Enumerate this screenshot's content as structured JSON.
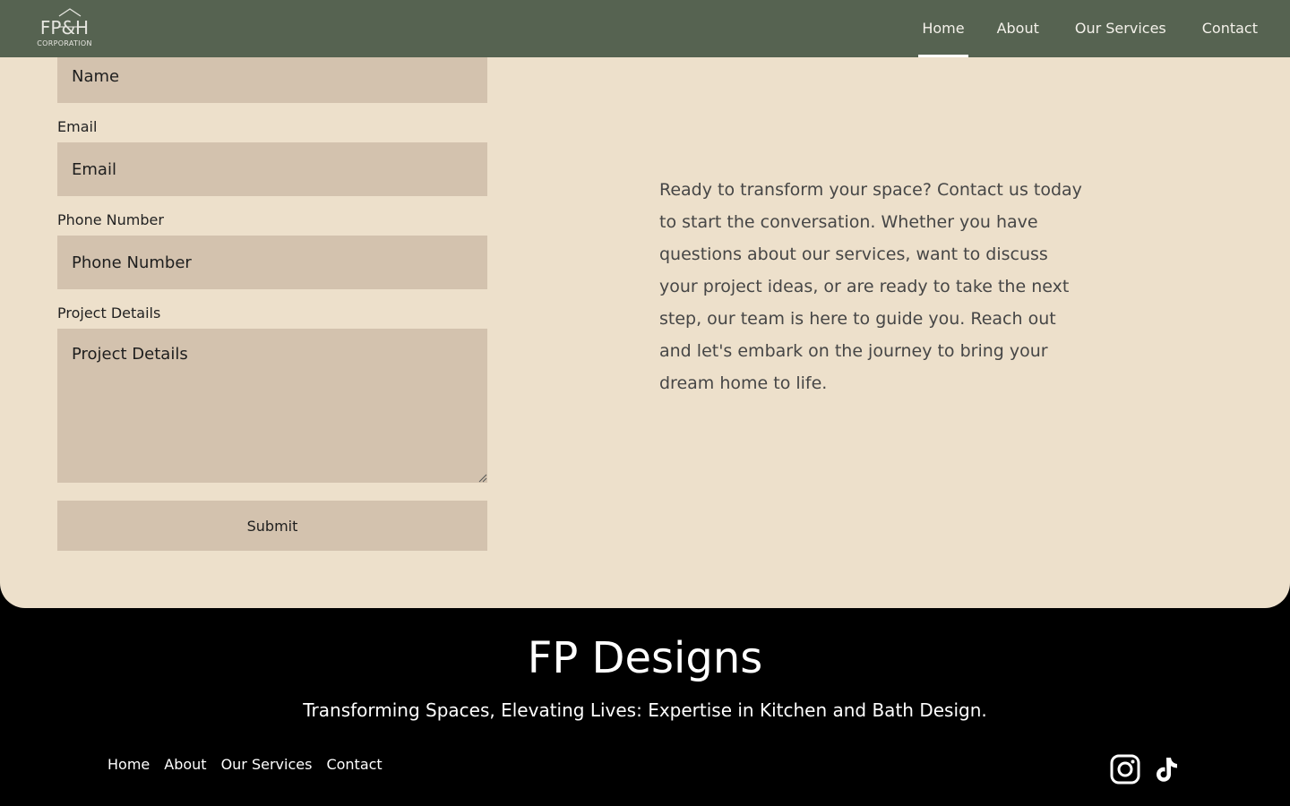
{
  "header": {
    "logo_mark": "FP&H",
    "logo_text": "CORPORATION",
    "nav": [
      {
        "label": "Home",
        "active": true
      },
      {
        "label": "About"
      },
      {
        "label": "Our Services"
      },
      {
        "label": "Contact"
      }
    ]
  },
  "form": {
    "name": {
      "placeholder": "Name"
    },
    "email": {
      "label": "Email",
      "placeholder": "Email"
    },
    "phone": {
      "label": "Phone Number",
      "placeholder": "Phone Number"
    },
    "details": {
      "label": "Project Details",
      "placeholder": "Project Details"
    },
    "submit_label": "Submit"
  },
  "intro_text": "Ready to transform your space? Contact us today to start the conversation. Whether you have questions about our services, want to discuss your project ideas, or are ready to take the next step, our team is here to guide you. Reach out and let's embark on the journey to bring your dream home to life.",
  "footer": {
    "title": "FP Designs",
    "tagline": "Transforming Spaces, Elevating Lives: Expertise in Kitchen and Bath Design.",
    "nav": [
      "Home",
      "About",
      "Our Services",
      "Contact"
    ],
    "social": [
      "instagram-icon",
      "tiktok-icon"
    ]
  },
  "colors": {
    "header_bg": "#566351",
    "section_bg": "#ede0cb",
    "field_bg": "#d3c2ae",
    "footer_bg": "#000000"
  }
}
